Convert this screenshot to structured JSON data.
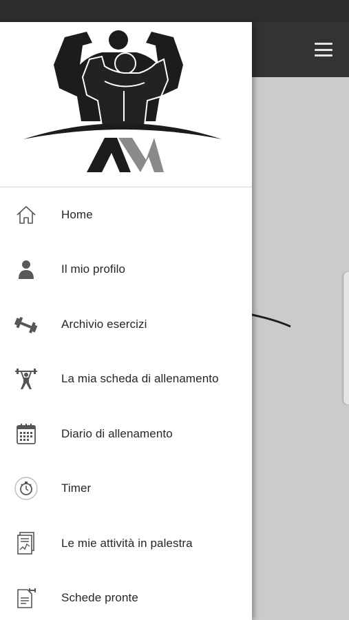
{
  "app": {
    "menu_icon": "hamburger-icon",
    "logo_alt": "AM"
  },
  "drawer": {
    "items": [
      {
        "label": "Home",
        "icon": "home-icon"
      },
      {
        "label": "Il mio profilo",
        "icon": "person-icon"
      },
      {
        "label": "Archivio esercizi",
        "icon": "dumbbell-icon"
      },
      {
        "label": "La mia scheda di allenamento",
        "icon": "weightlifter-icon"
      },
      {
        "label": "Diario di allenamento",
        "icon": "calendar-icon"
      },
      {
        "label": "Timer",
        "icon": "stopwatch-icon"
      },
      {
        "label": "Le mie attività in palestra",
        "icon": "activity-report-icon"
      },
      {
        "label": "Schede pronte",
        "icon": "workout-sheet-icon"
      }
    ]
  },
  "colors": {
    "app_bar": "#333333",
    "drawer_bg": "#ffffff",
    "scrim": "#c9c9c9",
    "icon": "#555555",
    "text": "#262626"
  }
}
